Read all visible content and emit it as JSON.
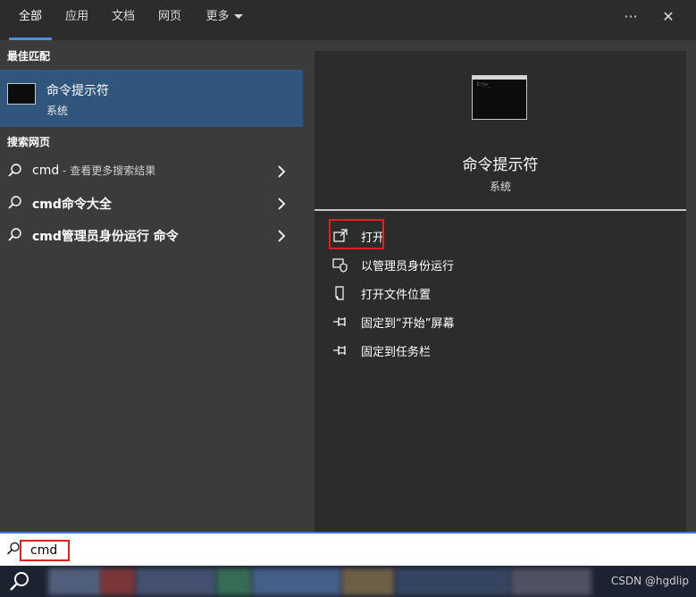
{
  "tabs": [
    {
      "label": "全部",
      "active": true
    },
    {
      "label": "应用"
    },
    {
      "label": "文档"
    },
    {
      "label": "网页"
    },
    {
      "label": "更多"
    }
  ],
  "top_icons": {
    "more": "···",
    "close": "✕"
  },
  "left": {
    "best_match_label": "最佳匹配",
    "best_match": {
      "title": "命令提示符",
      "subtitle": "系统",
      "icon": "terminal-icon"
    },
    "web_label": "搜索网页",
    "web_items": [
      {
        "main": "cmd",
        "suffix": " - 查看更多搜索结果"
      },
      {
        "main": "cmd命令大全",
        "suffix": ""
      },
      {
        "main": "cmd管理员身份运行 命令",
        "suffix": ""
      }
    ]
  },
  "preview": {
    "title": "命令提示符",
    "subtitle": "系统",
    "actions": [
      {
        "label": "打开",
        "icon": "open-icon"
      },
      {
        "label": "以管理员身份运行",
        "icon": "shield-icon"
      },
      {
        "label": "打开文件位置",
        "icon": "file-location-icon"
      },
      {
        "label": "固定到“开始”屏幕",
        "icon": "pin-icon"
      },
      {
        "label": "固定到任务栏",
        "icon": "pin-icon"
      }
    ]
  },
  "search": {
    "value": "cmd"
  },
  "taskbar": {
    "watermark": "CSDN @hgdlip"
  },
  "colors": {
    "accent": "#4a90e2",
    "highlight_box": "#e0201c",
    "selected_bg": "#31567e"
  }
}
